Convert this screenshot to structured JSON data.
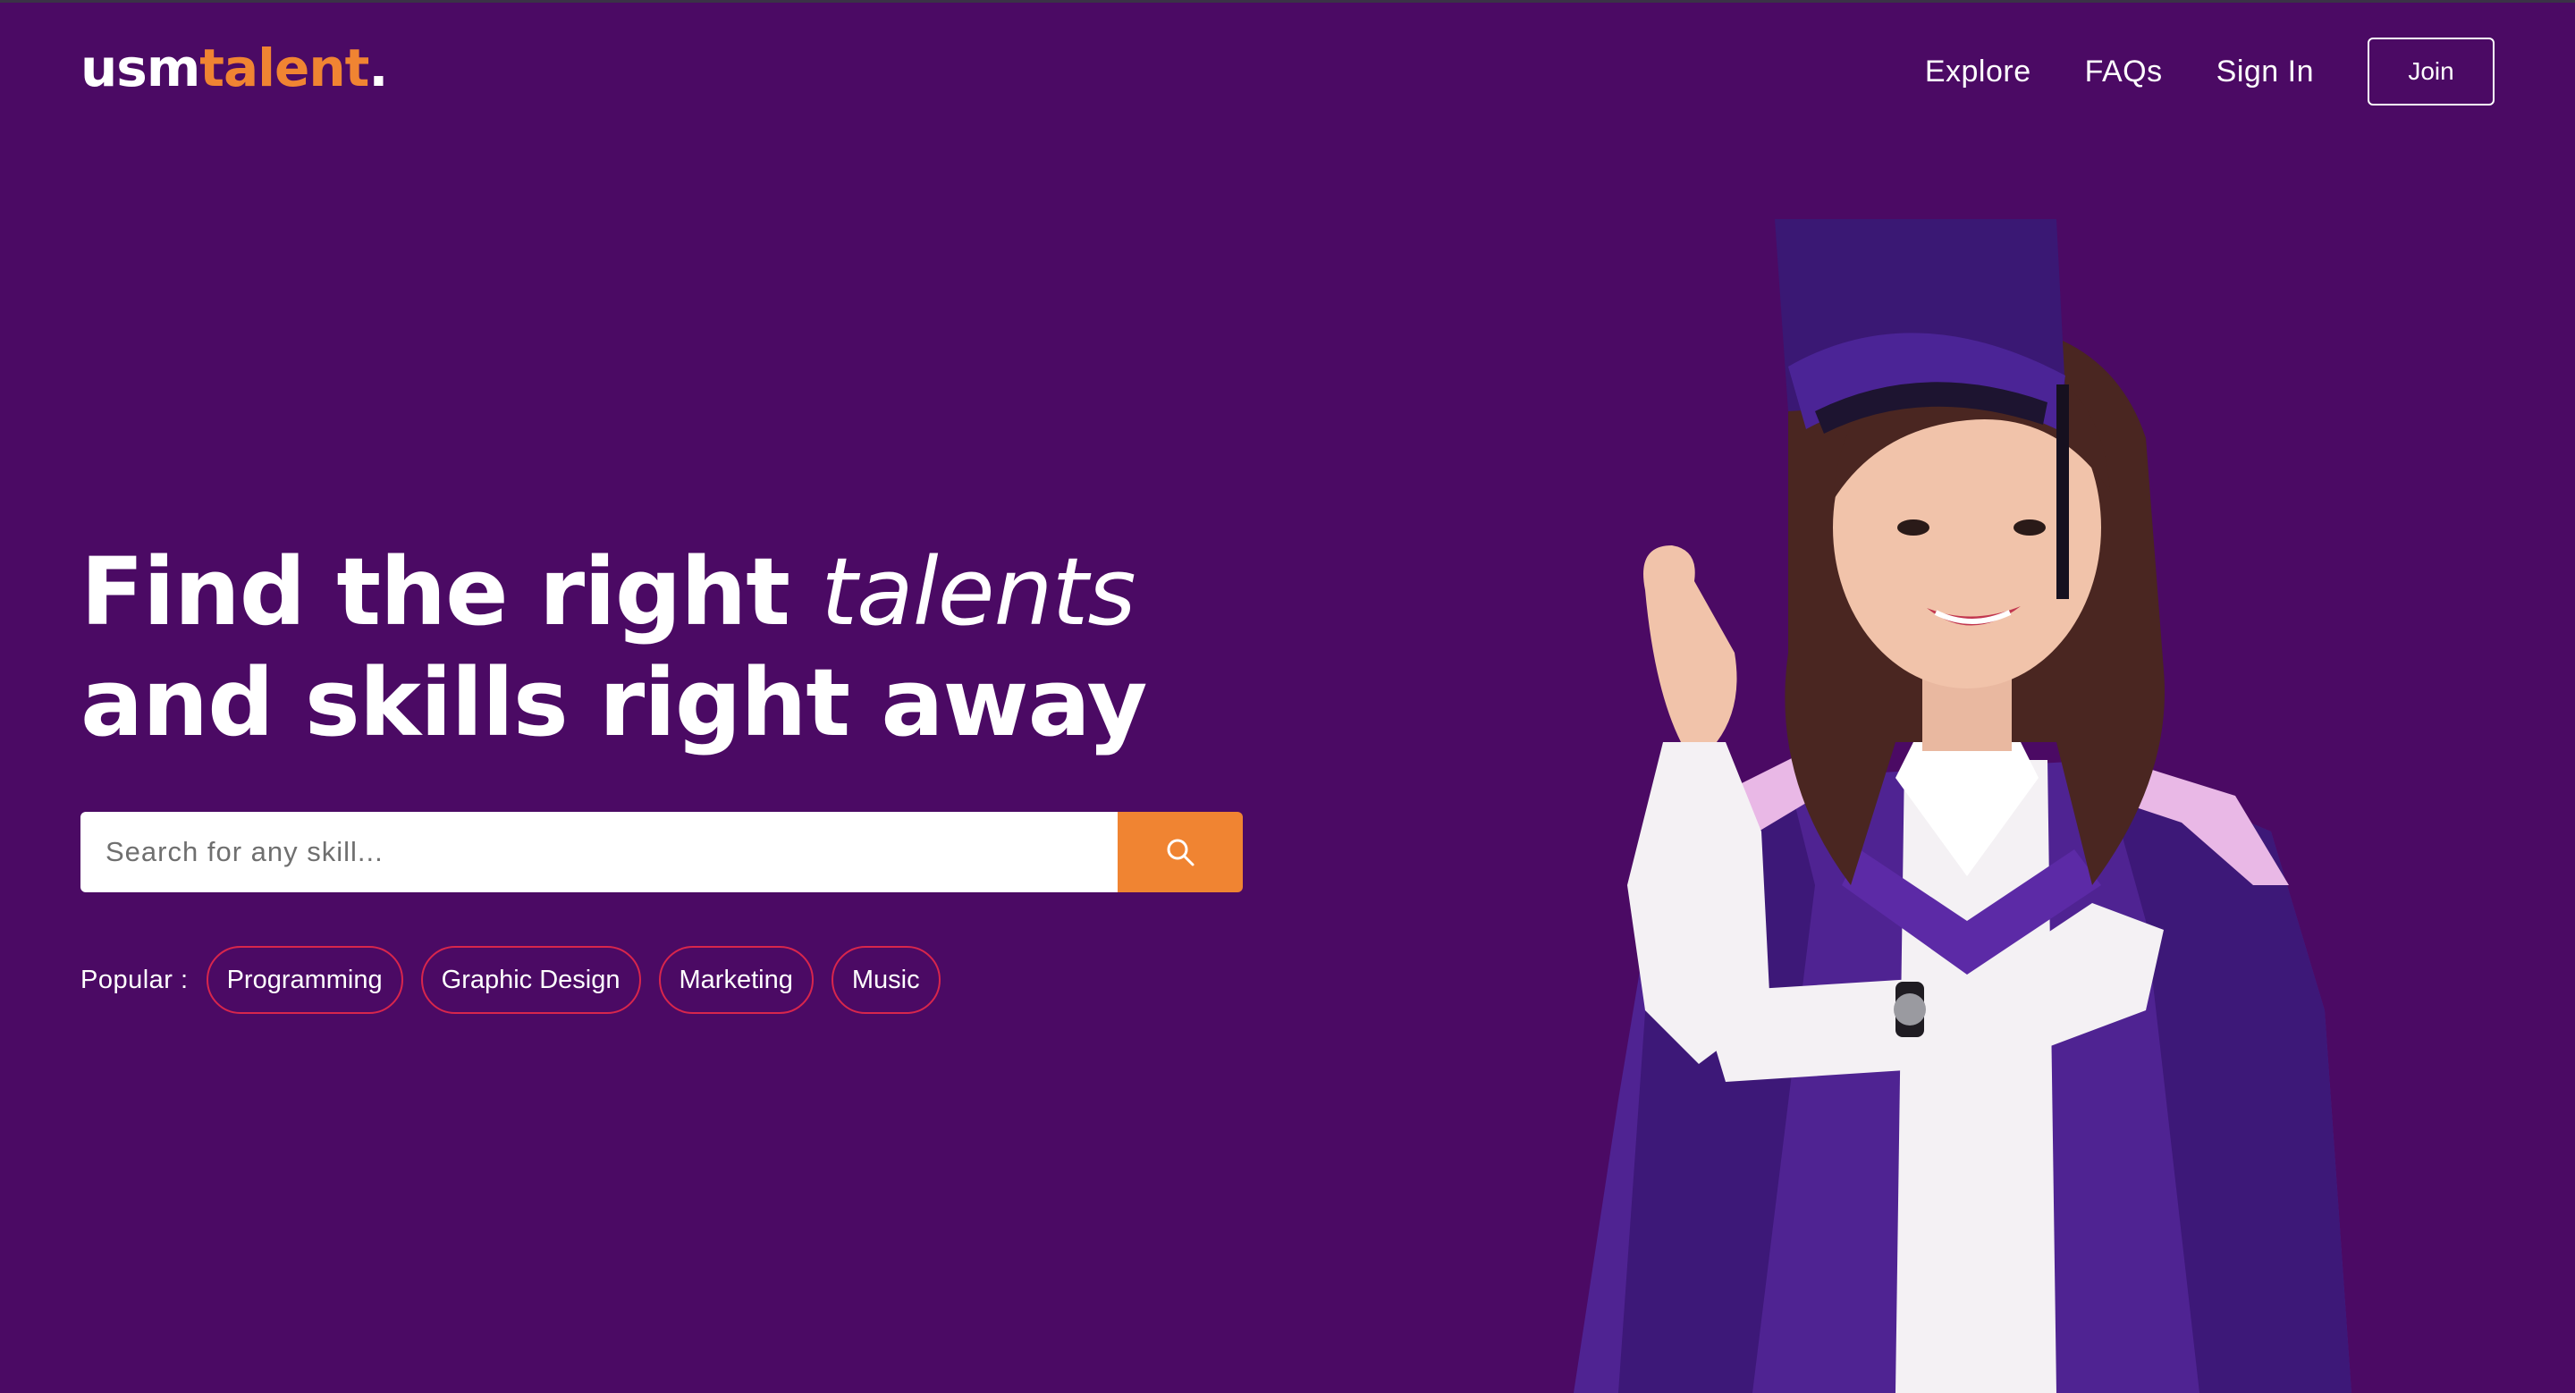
{
  "brand": {
    "part1": "usm",
    "part2": "talent",
    "part3": "."
  },
  "nav": {
    "explore": "Explore",
    "faqs": "FAQs",
    "sign_in": "Sign In",
    "join": "Join"
  },
  "hero": {
    "title_line1_bold": "Find the right ",
    "title_line1_italic": "talents",
    "title_line2": "and skills right away"
  },
  "search": {
    "placeholder": "Search for any skill...",
    "button_icon": "search-icon"
  },
  "popular": {
    "label": "Popular :",
    "tags": [
      "Programming",
      "Graphic Design",
      "Marketing",
      "Music"
    ]
  },
  "colors": {
    "background": "#4b0a64",
    "accent": "#f08432",
    "chip_border": "#d8264c"
  }
}
